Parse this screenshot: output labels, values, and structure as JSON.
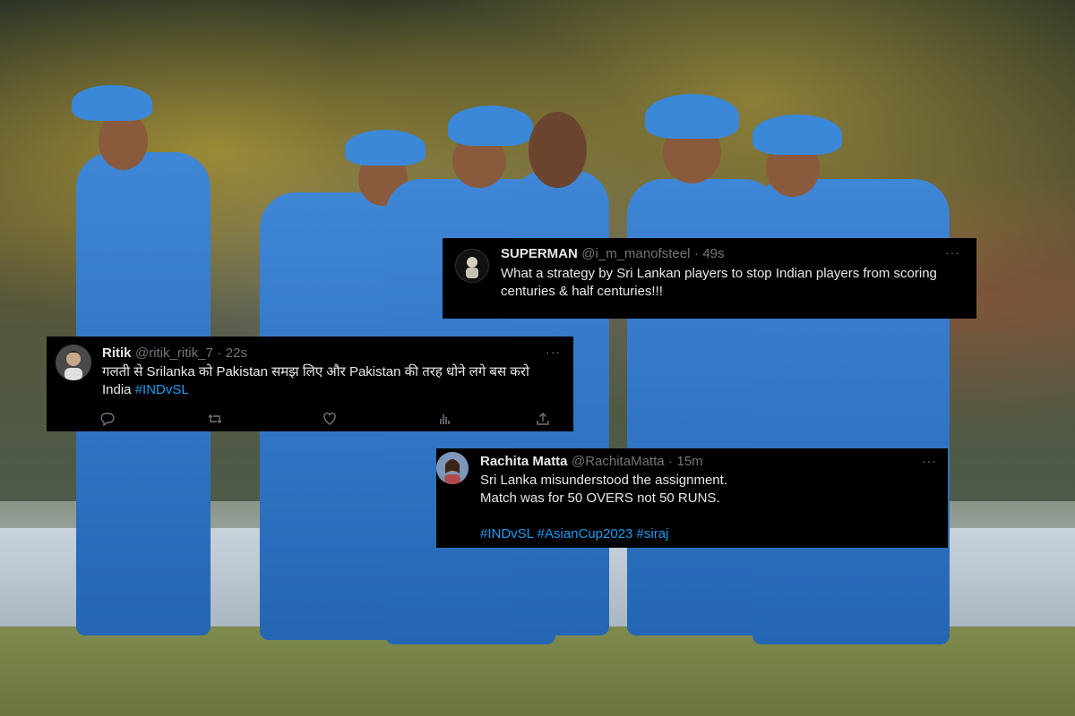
{
  "tweets": [
    {
      "name": "SUPERMAN",
      "handle": "@i_m_manofsteel",
      "separator": "·",
      "time": "49s",
      "body": "What a strategy by Sri Lankan players to stop Indian players from scoring centuries & half centuries!!!",
      "more": "···"
    },
    {
      "name": "Ritik",
      "handle": "@ritik_ritik_7",
      "separator": "·",
      "time": "22s",
      "body": "गलती से Srilanka को Pakistan समझ लिए और Pakistan की तरह धोने लगे बस करो India",
      "hashtag": "#INDvSL",
      "more": "···",
      "actions": [
        "reply-icon",
        "retweet-icon",
        "like-icon",
        "views-icon",
        "share-icon"
      ]
    },
    {
      "name": "Rachita Matta",
      "handle": "@RachitaMatta",
      "separator": "·",
      "time": "15m",
      "line1": "Sri Lanka misunderstood the assignment.",
      "line2": "Match was for 50 OVERS not 50 RUNS.",
      "hashtags": "#INDvSL #AsianCup2023 #siraj",
      "more": "···"
    }
  ],
  "colors": {
    "tweet_bg": "#000000",
    "text": "#e7e9ea",
    "muted": "#71767b",
    "link": "#1d9bf0",
    "jersey": "#2f7bd0"
  }
}
